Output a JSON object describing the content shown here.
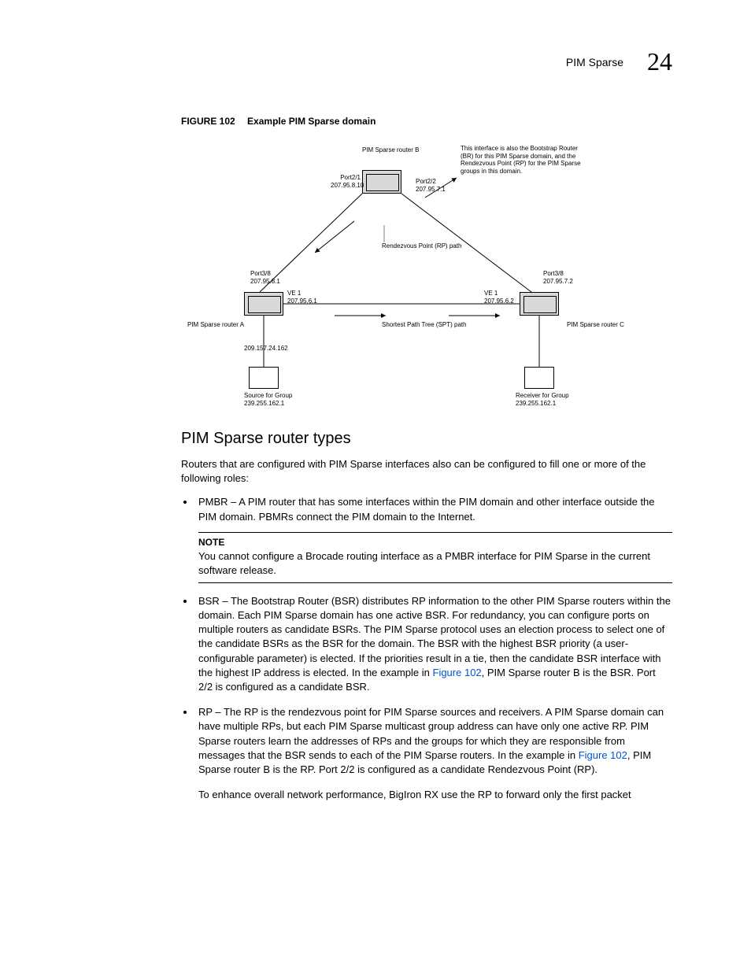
{
  "header": {
    "title": "PIM Sparse",
    "chapter": "24"
  },
  "figure": {
    "label": "FIGURE 102",
    "caption": "Example PIM Sparse domain"
  },
  "diagram": {
    "routerB": "PIM Sparse router B",
    "bsrNote": "This interface is also the Bootstrap Router (BR) for this PIM Sparse domain, and the Rendezvous Point (RP) for the PIM Sparse groups in this domain.",
    "port21": "Port2/1",
    "ip21": "207.95.8.10",
    "port22": "Port2/2",
    "ip22": "207.95.7.1",
    "rpPath": "Rendezvous Point (RP) path",
    "port38a": "Port3/8",
    "ip38a": "207.95.8.1",
    "port38c": "Port3/8",
    "ip38c": "207.95.7.2",
    "ve1a": "VE 1",
    "ipve1a": "207.95.6.1",
    "ve1c": "VE 1",
    "ipve1c": "207.95.6.2",
    "sptPath": "Shortest Path Tree (SPT) path",
    "routerA": "PIM Sparse router A",
    "routerC": "PIM Sparse router C",
    "srcIp": "209.157.24.162",
    "source": "Source for Group",
    "sourceIp": "239.255.162.1",
    "receiver": "Receiver for Group",
    "receiverIp": "239.255.162.1"
  },
  "section": {
    "heading": "PIM Sparse router types",
    "intro": "Routers that are configured with PIM Sparse interfaces also can be configured to fill one or more of the following roles:",
    "bullet1": "PMBR – A PIM router that has some interfaces within the PIM domain and other interface outside the PIM domain. PBMRs connect the PIM domain to the Internet.",
    "noteLabel": "NOTE",
    "noteText": "You cannot configure a Brocade routing interface as a PMBR interface for PIM Sparse in the current software release.",
    "bullet2a": "BSR – The Bootstrap Router (BSR) distributes RP information to the other PIM Sparse routers within the domain. Each PIM Sparse domain has one active BSR. For redundancy, you can configure ports on multiple routers as candidate BSRs. The PIM Sparse protocol uses an election process to select one of the candidate BSRs as the BSR for the domain. The BSR with the highest BSR priority (a user-configurable parameter) is elected. If the priorities result in a tie, then the candidate BSR interface with the highest IP address is elected. In the example in ",
    "figref": "Figure 102",
    "bullet2b": ", PIM Sparse router B is the BSR. Port 2/2 is configured as a candidate BSR.",
    "bullet3a": "RP – The RP is the rendezvous point for PIM Sparse sources and receivers. A PIM Sparse domain can have multiple RPs, but each PIM Sparse multicast group address can have only one active RP. PIM Sparse routers learn the addresses of RPs and the groups for which they are responsible from messages that the BSR sends to each of the PIM Sparse routers. In the example in ",
    "bullet3b": ", PIM Sparse router B is the RP. Port 2/2 is configured as a candidate Rendezvous Point (RP).",
    "bullet3final": "To enhance overall network performance, BigIron RX use the RP to forward only the first packet"
  }
}
